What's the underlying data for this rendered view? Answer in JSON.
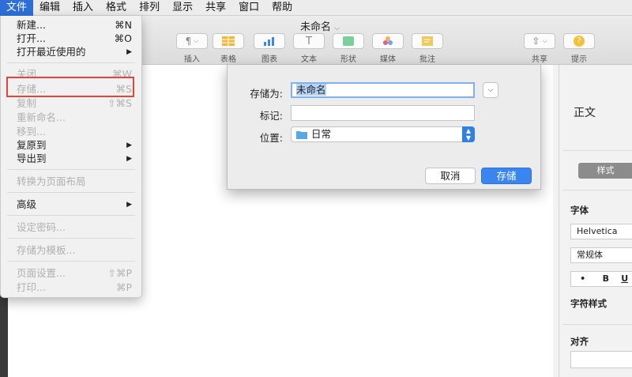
{
  "menubar": {
    "items": [
      "文件",
      "编辑",
      "插入",
      "格式",
      "排列",
      "显示",
      "共享",
      "窗口",
      "帮助"
    ]
  },
  "window": {
    "title": "未命名",
    "toolbar": {
      "insert": "插入",
      "table": "表格",
      "chart": "图表",
      "text": "文本",
      "shape": "形状",
      "media": "媒体",
      "comment": "批注",
      "share": "共享",
      "tips": "提示"
    }
  },
  "file_menu": {
    "items": [
      {
        "label": "新建...",
        "shortcut": "⌘N"
      },
      {
        "label": "打开...",
        "shortcut": "⌘O"
      },
      {
        "label": "打开最近使用的",
        "shortcut": "▶"
      },
      {
        "label": "关闭",
        "shortcut": "⌘W"
      },
      {
        "label": "存储...",
        "shortcut": "⌘S"
      },
      {
        "label": "复制",
        "shortcut": "⇧⌘S"
      },
      {
        "label": "重新命名...",
        "shortcut": ""
      },
      {
        "label": "移到...",
        "shortcut": ""
      },
      {
        "label": "复原到",
        "shortcut": "▶"
      },
      {
        "label": "导出到",
        "shortcut": "▶"
      },
      {
        "label": "转换为页面布局",
        "shortcut": ""
      },
      {
        "label": "高级",
        "shortcut": "▶"
      },
      {
        "label": "设定密码...",
        "shortcut": ""
      },
      {
        "label": "存储为模板...",
        "shortcut": ""
      },
      {
        "label": "页面设置...",
        "shortcut": "⇧⌘P"
      },
      {
        "label": "打印...",
        "shortcut": "⌘P"
      }
    ]
  },
  "save_dialog": {
    "save_as_label": "存储为:",
    "save_as_value": "未命名",
    "tags_label": "标记:",
    "tags_value": "",
    "location_label": "位置:",
    "location_value": "日常",
    "cancel_label": "取消",
    "save_label": "存储"
  },
  "format_panel": {
    "style_heading": "正文",
    "style_button": "样式",
    "font_label": "字体",
    "font_family": "Helvetica",
    "font_weight": "常规体",
    "bold": "B",
    "underline": "U",
    "bullet": "•",
    "char_style_label": "字符样式",
    "align_label": "对齐"
  },
  "colors": {
    "menu_highlight": "#2d6fd6",
    "annotation_box": "#e2453c",
    "primary_button": "#3a86f0"
  }
}
